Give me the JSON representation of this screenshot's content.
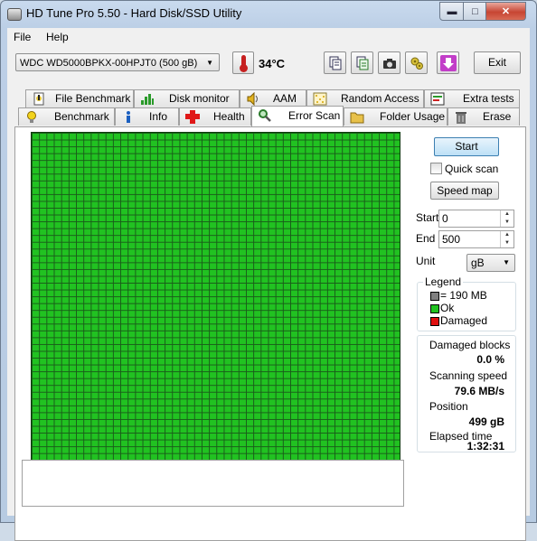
{
  "window": {
    "title": "HD Tune Pro 5.50 - Hard Disk/SSD Utility"
  },
  "menu": {
    "file": "File",
    "help": "Help"
  },
  "toolbar": {
    "drive": "WDC WD5000BPKX-00HPJT0 (500 gB)",
    "temperature": "34°C",
    "exit_label": "Exit"
  },
  "tabs_top": [
    "File Benchmark",
    "Disk monitor",
    "AAM",
    "Random Access",
    "Extra tests"
  ],
  "tabs_bottom": [
    "Benchmark",
    "Info",
    "Health",
    "Error Scan",
    "Folder Usage",
    "Erase"
  ],
  "scan": {
    "start_button": "Start",
    "quick_scan_label": "Quick scan",
    "quick_scan_checked": false,
    "speed_map_button": "Speed map",
    "start_label": "Start",
    "start_value": "0",
    "end_label": "End",
    "end_value": "500",
    "unit_label": "Unit",
    "unit_value": "gB"
  },
  "legend": {
    "title": "Legend",
    "block_size": "= 190 MB",
    "ok": "Ok",
    "damaged": "Damaged",
    "colors": {
      "block": "#808080",
      "ok": "#21c221",
      "damaged": "#e01010"
    }
  },
  "stats": {
    "damaged_blocks_label": "Damaged blocks",
    "damaged_blocks_value": "0.0 %",
    "scanning_speed_label": "Scanning speed",
    "scanning_speed_value": "79.6 MB/s",
    "position_label": "Position",
    "position_value": "499 gB",
    "elapsed_label": "Elapsed time",
    "elapsed_value": "1:32:31"
  }
}
